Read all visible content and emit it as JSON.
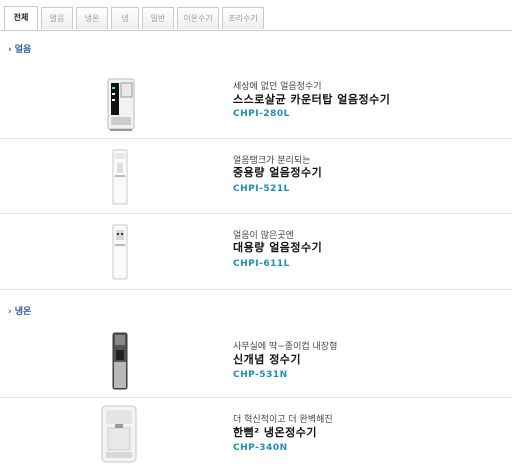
{
  "tabs": [
    {
      "label": "전체",
      "active": true
    },
    {
      "label": "얼음",
      "active": false
    },
    {
      "label": "냉온",
      "active": false
    },
    {
      "label": "냉",
      "active": false
    },
    {
      "label": "일반",
      "active": false
    },
    {
      "label": "이온수기",
      "active": false
    },
    {
      "label": "조리수기",
      "active": false
    }
  ],
  "sections": [
    {
      "title": "얼음",
      "products": [
        {
          "tagline": "세상에 없던 얼음정수기",
          "name": "스스로살균 카운터탑 얼음정수기",
          "model": "CHPI-280L"
        },
        {
          "tagline": "얼음탱크가 분리되는",
          "name": "중용량 얼음정수기",
          "model": "CHPI-521L"
        },
        {
          "tagline": "얼음이 많은곳엔",
          "name": "대용량 얼음정수기",
          "model": "CHPI-611L"
        }
      ]
    },
    {
      "title": "냉온",
      "products": [
        {
          "tagline": "사무실에 딱~종이컵 내장형",
          "name": "신개념 정수기",
          "model": "CHP-531N"
        },
        {
          "tagline": "더 혁신적이고 더 완벽해진",
          "name": "한뼘² 냉온정수기",
          "model": "CHP-340N"
        }
      ]
    }
  ],
  "colors": {
    "accent": "#2c5aa0",
    "model": "#1d8fb5"
  }
}
